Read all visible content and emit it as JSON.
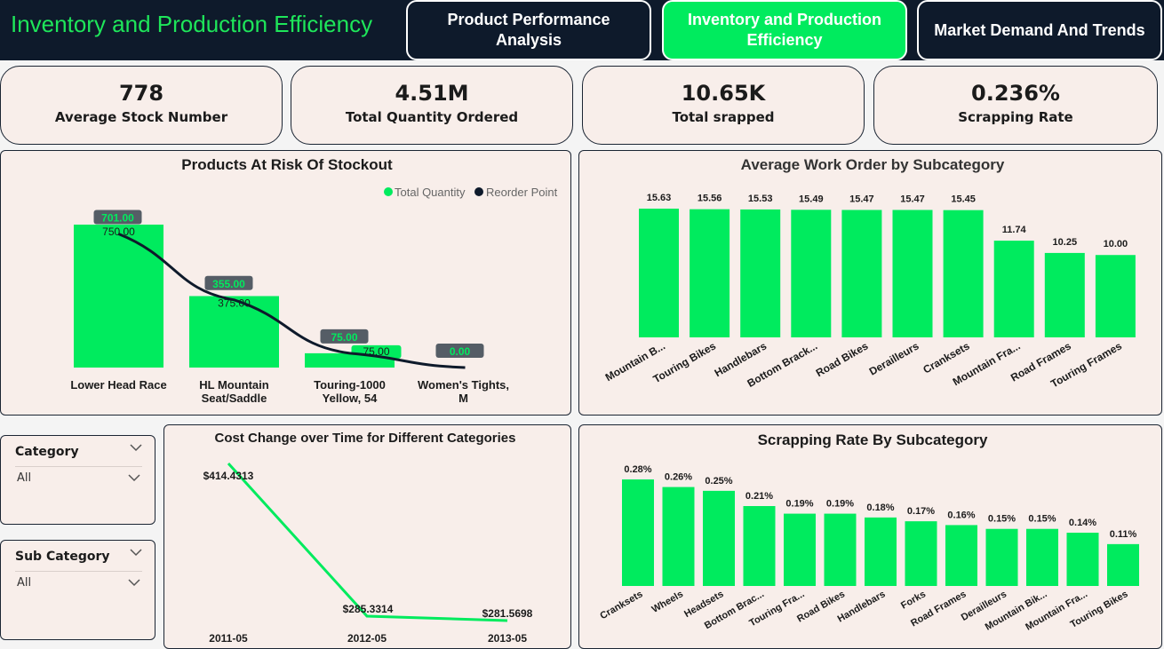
{
  "header": {
    "title": "Inventory and Production Efficiency",
    "tabs": [
      {
        "label": "Product Performance Analysis"
      },
      {
        "label": "Inventory and Production Efficiency"
      },
      {
        "label": "Market Demand And Trends"
      }
    ],
    "accent": "#00EB5E",
    "dark": "#0E1A2B"
  },
  "kpis": [
    {
      "value": "778",
      "label": "Average Stock Number"
    },
    {
      "value": "4.51M",
      "label": "Total Quantity Ordered"
    },
    {
      "value": "10.65K",
      "label": "Total srapped"
    },
    {
      "value": "0.236%",
      "label": "Scrapping Rate"
    }
  ],
  "slicers": [
    {
      "title": "Category",
      "value": "All"
    },
    {
      "title": "Sub Category",
      "value": "All"
    }
  ],
  "chart_data": [
    {
      "type": "bar",
      "title": "Products At Risk Of Stockout",
      "categories": [
        "Lower Head Race",
        "HL Mountain Seat/Saddle",
        "Touring-1000 Yellow, 54",
        "Women's Tights, M"
      ],
      "category_lines": [
        [
          "Lower Head Race"
        ],
        [
          "HL Mountain",
          "Seat/Saddle"
        ],
        [
          "Touring-1000",
          "Yellow, 54"
        ],
        [
          "Women's Tights,",
          "M"
        ]
      ],
      "series": [
        {
          "name": "Total Quantity",
          "type": "bar",
          "values": [
            750,
            375,
            75,
            0
          ],
          "labels": [
            "750.00",
            "375.00",
            "75.00",
            ""
          ],
          "color": "#00EB5E"
        },
        {
          "name": "Reorder Point",
          "type": "line",
          "values": [
            701,
            355,
            75,
            0
          ],
          "labels": [
            "701.00",
            "355.00",
            "75.00",
            "0.00"
          ],
          "color": "#0E1A2B"
        }
      ],
      "ylim": [
        0,
        800
      ],
      "legend": "top-right"
    },
    {
      "type": "bar",
      "title": "Average Work Order by Subcategory",
      "categories": [
        "Mountain B...",
        "Touring Bikes",
        "Handlebars",
        "Bottom Brack...",
        "Road Bikes",
        "Derailleurs",
        "Cranksets",
        "Mountain Fra...",
        "Road Frames",
        "Touring Frames"
      ],
      "values": [
        15.63,
        15.56,
        15.53,
        15.49,
        15.47,
        15.47,
        15.45,
        11.74,
        10.25,
        10.0
      ],
      "labels": [
        "15.63",
        "15.56",
        "15.53",
        "15.49",
        "15.47",
        "15.47",
        "15.45",
        "11.74",
        "10.25",
        "10.00"
      ],
      "ylim": [
        0,
        16
      ]
    },
    {
      "type": "line",
      "title": "Cost Change over Time for Different Categories",
      "x": [
        "2011-05",
        "2012-05",
        "2013-05"
      ],
      "values": [
        414.4313,
        285.3314,
        281.5698
      ],
      "labels": [
        "$414.4313",
        "$285.3314",
        "$281.5698"
      ],
      "ylim": [
        270,
        420
      ]
    },
    {
      "type": "bar",
      "title": "Scrapping Rate By Subcategory",
      "categories": [
        "Cranksets",
        "Wheels",
        "Headsets",
        "Bottom Brac...",
        "Touring Fra...",
        "Road Bikes",
        "Handlebars",
        "Forks",
        "Road Frames",
        "Derailleurs",
        "Mountain Bik...",
        "Mountain Fra...",
        "Touring Bikes"
      ],
      "values": [
        0.28,
        0.26,
        0.25,
        0.21,
        0.19,
        0.19,
        0.18,
        0.17,
        0.16,
        0.15,
        0.15,
        0.14,
        0.11
      ],
      "labels": [
        "0.28%",
        "0.26%",
        "0.25%",
        "0.21%",
        "0.19%",
        "0.19%",
        "0.18%",
        "0.17%",
        "0.16%",
        "0.15%",
        "0.15%",
        "0.14%",
        "0.11%"
      ],
      "ylim": [
        0,
        0.3
      ]
    }
  ]
}
